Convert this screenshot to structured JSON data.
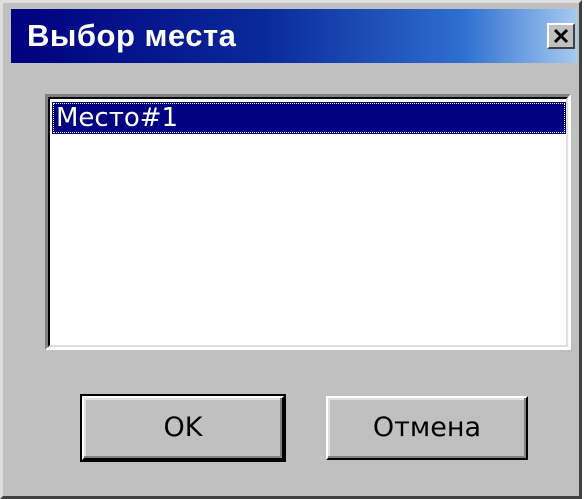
{
  "window": {
    "title": "Выбор места"
  },
  "list": {
    "items": [
      {
        "label": "Место#1",
        "selected": true
      }
    ]
  },
  "buttons": {
    "ok_label": "OK",
    "cancel_label": "Отмена"
  },
  "colors": {
    "face": "#c0c0c0",
    "selection": "#000080",
    "title_start": "#000080",
    "title_end": "#a6caf0"
  },
  "icons": {
    "close": "close-icon"
  }
}
